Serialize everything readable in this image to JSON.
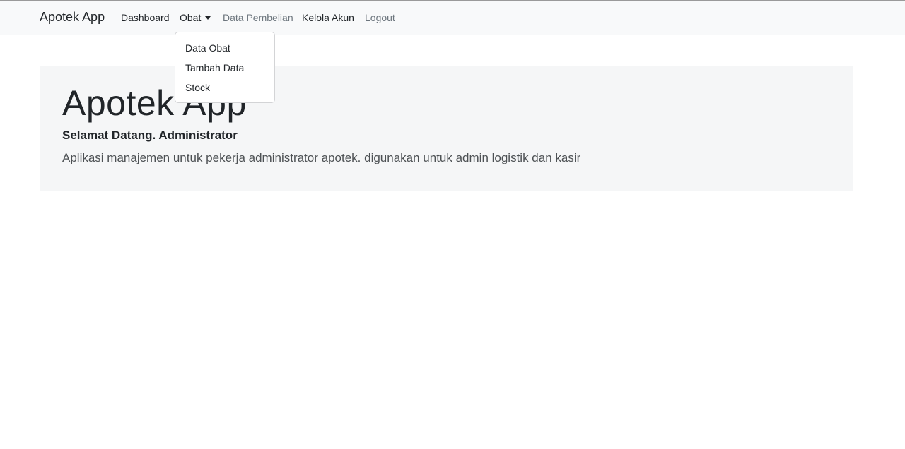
{
  "navbar": {
    "brand": "Apotek App",
    "links": [
      {
        "label": "Dashboard"
      },
      {
        "label": "Obat"
      },
      {
        "label": "Data Pembelian"
      },
      {
        "label": "Kelola Akun"
      },
      {
        "label": "Logout"
      }
    ],
    "dropdown": {
      "open": true,
      "items": [
        {
          "label": "Data Obat"
        },
        {
          "label": "Tambah Data"
        },
        {
          "label": "Stock"
        }
      ]
    }
  },
  "hero": {
    "title": "Apotek App",
    "welcome": "Selamat Datang. Administrator",
    "lead": "Aplikasi manajemen untuk pekerja administrator apotek. digunakan untuk admin logistik dan kasir"
  },
  "colors": {
    "navbar_bg": "#f8f9fa",
    "hero_bg": "#f5f6f7",
    "text": "#212529",
    "muted": "#6c757d"
  }
}
